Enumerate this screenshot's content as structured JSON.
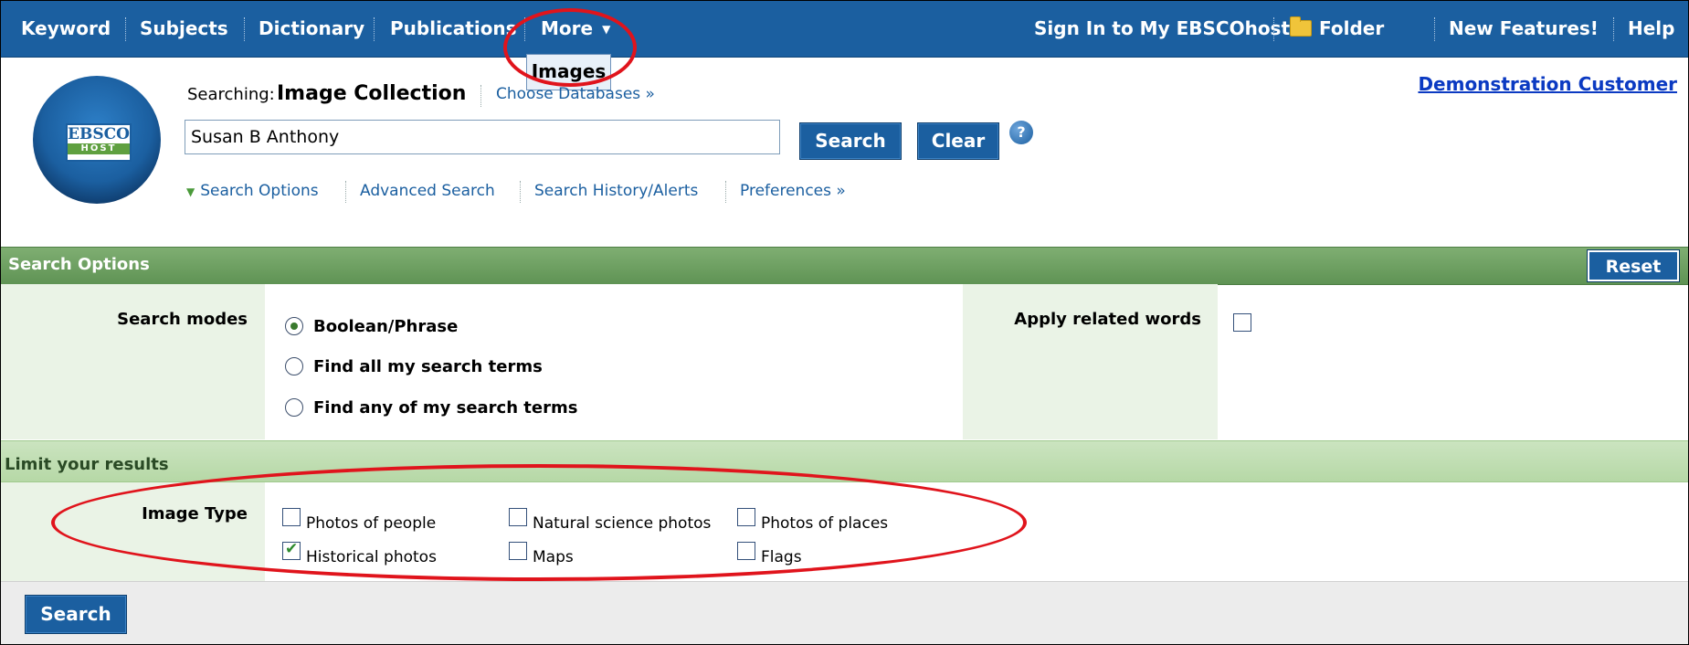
{
  "topnav": {
    "items": [
      "Keyword",
      "Subjects",
      "Dictionary",
      "Publications",
      "More"
    ],
    "more_dropdown": [
      "Images"
    ],
    "right_items": [
      "Sign In to My EBSCOhost",
      "Folder",
      "New Features!",
      "Help"
    ]
  },
  "header": {
    "logo_text": "EBSCO",
    "logo_sub": "HOST",
    "searching_label": "Searching:",
    "database_name": "Image Collection",
    "choose_databases": "Choose Databases »",
    "search_value": "Susan B Anthony",
    "search_button": "Search",
    "clear_button": "Clear",
    "help": "?",
    "links": [
      "Search Options",
      "Advanced Search",
      "Search History/Alerts",
      "Preferences »"
    ],
    "customer": "Demonstration Customer"
  },
  "search_options": {
    "title": "Search Options",
    "reset_button": "Reset",
    "modes_label": "Search modes",
    "modes": [
      "Boolean/Phrase",
      "Find all my search terms",
      "Find any of my search terms"
    ],
    "selected_mode": 0,
    "related_words_label": "Apply related words",
    "related_words_checked": false
  },
  "limits": {
    "title": "Limit your results",
    "image_type_label": "Image Type",
    "image_types": [
      {
        "label": "Photos of people",
        "checked": false
      },
      {
        "label": "Natural science photos",
        "checked": false
      },
      {
        "label": "Photos of places",
        "checked": false
      },
      {
        "label": "Historical photos",
        "checked": true
      },
      {
        "label": "Maps",
        "checked": false
      },
      {
        "label": "Flags",
        "checked": false
      }
    ]
  },
  "bottom": {
    "search_button": "Search"
  },
  "colors": {
    "nav_blue": "#1b5fa0",
    "options_green": "#6f9f63",
    "limit_green": "#c0ddb2",
    "annotation_red": "#e0141c",
    "link_blue": "#0b3ac2"
  }
}
